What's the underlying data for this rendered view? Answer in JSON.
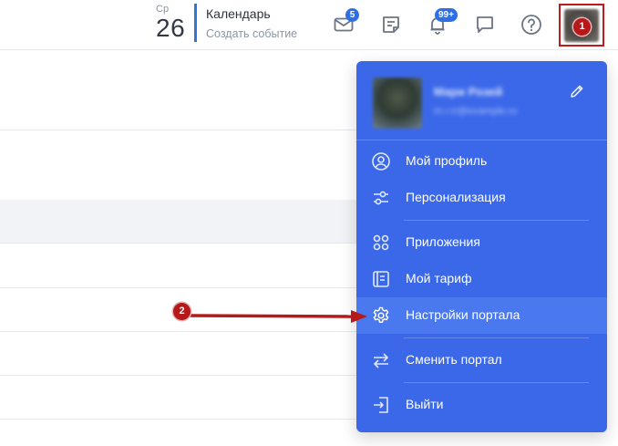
{
  "header": {
    "date": {
      "weekday": "Ср",
      "day": "26"
    },
    "calendar": {
      "title": "Календарь",
      "subtitle": "Создать событие"
    },
    "mail_badge": "5",
    "notifications_badge": "99+"
  },
  "annotations": {
    "marker_1": "1",
    "marker_2": "2"
  },
  "profile_menu": {
    "user_name": "Мари Розей",
    "user_email": "m.r.rr@example.ru",
    "items": [
      {
        "label": "Мой профиль",
        "icon": "user-circle-icon"
      },
      {
        "label": "Персонализация",
        "icon": "sliders-icon"
      },
      {
        "label": "Приложения",
        "icon": "apps-grid-icon"
      },
      {
        "label": "Мой тариф",
        "icon": "plan-card-icon"
      },
      {
        "label": "Настройки портала",
        "icon": "gear-icon"
      },
      {
        "label": "Сменить портал",
        "icon": "switch-arrows-icon"
      },
      {
        "label": "Выйти",
        "icon": "logout-icon"
      }
    ]
  },
  "colors": {
    "menu_bg": "#3b68e9",
    "menu_active": "#4a78ee",
    "accent_bar": "#2f7ad1",
    "badge": "#2f6fe4",
    "annotation_red": "#b51919"
  }
}
